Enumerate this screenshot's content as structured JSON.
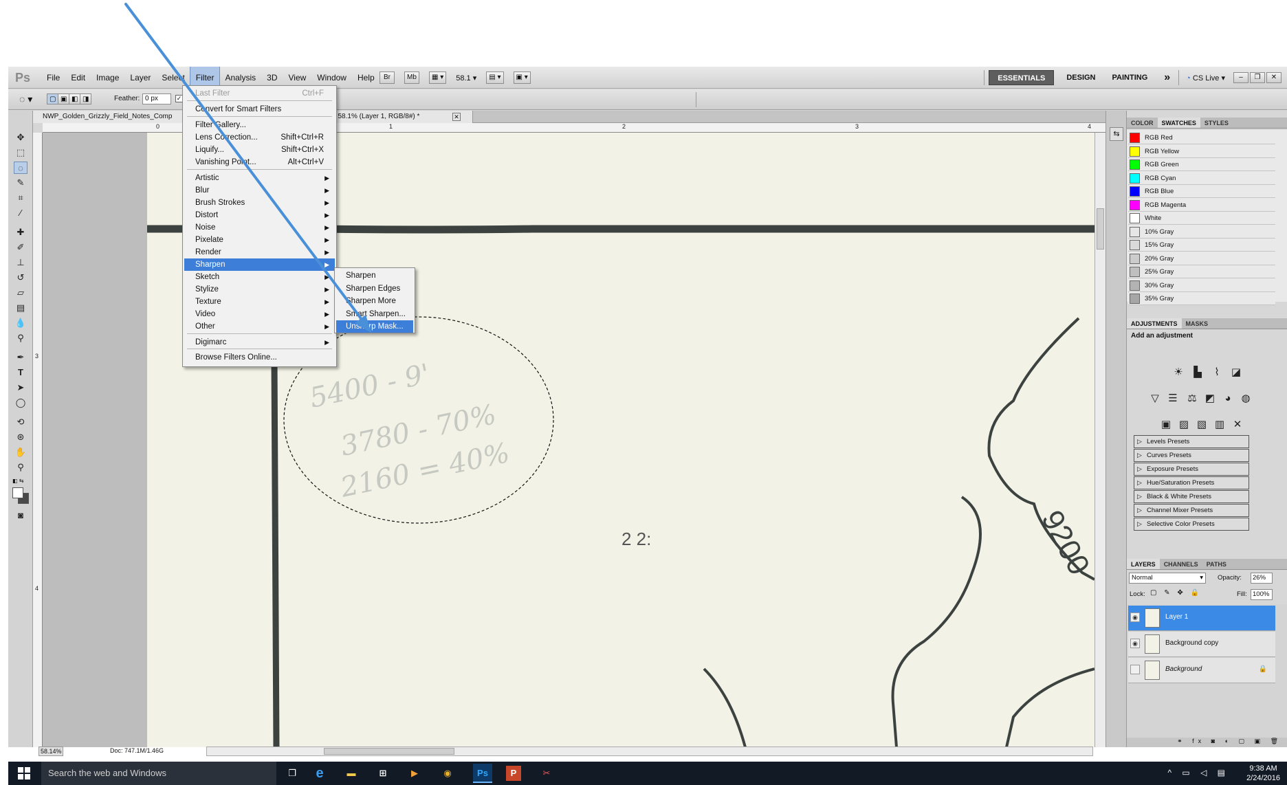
{
  "menubar": {
    "logo": "Ps",
    "menus": [
      "File",
      "Edit",
      "Image",
      "Layer",
      "Select",
      "Filter",
      "Analysis",
      "3D",
      "View",
      "Window",
      "Help"
    ],
    "active_menu": "Filter",
    "bridge_btn": "Br",
    "minibridge_btn": "Mb",
    "zoom": "58.1",
    "workspaces": [
      "ESSENTIALS",
      "DESIGN",
      "PAINTING"
    ],
    "active_workspace": "ESSENTIALS",
    "more": "»",
    "cs_live": "CS Live"
  },
  "options": {
    "feather_label": "Feather:",
    "feather_value": "0 px"
  },
  "document": {
    "tab_title_left": "NWP_Golden_Grizzly_Field_Notes_Comp",
    "tab_title_right": "tif @ 58.1% (Layer 1, RGB/8#) *",
    "close": "✕"
  },
  "rulers": {
    "top": [
      "0",
      "1",
      "2",
      "3",
      "4"
    ],
    "left": [
      "3",
      "4"
    ]
  },
  "filter_menu": {
    "items": [
      {
        "label": "Last Filter",
        "shortcut": "Ctrl+F",
        "disabled": true
      },
      {
        "label": "Convert for Smart Filters",
        "shortcut": ""
      },
      {
        "label": "Filter Gallery...",
        "shortcut": ""
      },
      {
        "label": "Lens Correction...",
        "shortcut": "Shift+Ctrl+R"
      },
      {
        "label": "Liquify...",
        "shortcut": "Shift+Ctrl+X"
      },
      {
        "label": "Vanishing Point...",
        "shortcut": "Alt+Ctrl+V"
      },
      {
        "label": "Artistic"
      },
      {
        "label": "Blur"
      },
      {
        "label": "Brush Strokes"
      },
      {
        "label": "Distort"
      },
      {
        "label": "Noise"
      },
      {
        "label": "Pixelate"
      },
      {
        "label": "Render"
      },
      {
        "label": "Sharpen"
      },
      {
        "label": "Sketch"
      },
      {
        "label": "Stylize"
      },
      {
        "label": "Texture"
      },
      {
        "label": "Video"
      },
      {
        "label": "Other"
      },
      {
        "label": "Digimarc"
      },
      {
        "label": "Browse Filters Online..."
      }
    ],
    "highlighted": "Sharpen"
  },
  "sharpen_submenu": {
    "items": [
      "Sharpen",
      "Sharpen Edges",
      "Sharpen More",
      "Smart Sharpen...",
      "Unsharp Mask..."
    ],
    "highlighted": "Unsharp Mask..."
  },
  "swatches_panel": {
    "tabs": [
      "COLOR",
      "SWATCHES",
      "STYLES"
    ],
    "active_tab": "SWATCHES",
    "swatches": [
      {
        "name": "RGB Red",
        "color": "#ff0000"
      },
      {
        "name": "RGB Yellow",
        "color": "#ffff00"
      },
      {
        "name": "RGB Green",
        "color": "#00ff00"
      },
      {
        "name": "RGB Cyan",
        "color": "#00ffff"
      },
      {
        "name": "RGB Blue",
        "color": "#0000ff"
      },
      {
        "name": "RGB Magenta",
        "color": "#ff00ff"
      },
      {
        "name": "White",
        "color": "#ffffff"
      },
      {
        "name": "10% Gray",
        "color": "#e6e6e6"
      },
      {
        "name": "15% Gray",
        "color": "#d9d9d9"
      },
      {
        "name": "20% Gray",
        "color": "#cccccc"
      },
      {
        "name": "25% Gray",
        "color": "#bfbfbf"
      },
      {
        "name": "30% Gray",
        "color": "#b3b3b3"
      },
      {
        "name": "35% Gray",
        "color": "#a6a6a6"
      }
    ]
  },
  "adjustments_panel": {
    "tabs": [
      "ADJUSTMENTS",
      "MASKS"
    ],
    "active_tab": "ADJUSTMENTS",
    "heading": "Add an adjustment",
    "presets": [
      "Levels Presets",
      "Curves Presets",
      "Exposure Presets",
      "Hue/Saturation Presets",
      "Black & White Presets",
      "Channel Mixer Presets",
      "Selective Color Presets"
    ]
  },
  "layers_panel": {
    "tabs": [
      "LAYERS",
      "CHANNELS",
      "PATHS"
    ],
    "active_tab": "LAYERS",
    "blend_mode": "Normal",
    "opacity_label": "Opacity:",
    "opacity": "26%",
    "lock_label": "Lock:",
    "fill_label": "Fill:",
    "fill": "100%",
    "layers": [
      {
        "name": "Layer 1",
        "selected": true
      },
      {
        "name": "Background copy",
        "selected": false
      },
      {
        "name": "Background",
        "selected": false,
        "locked": true
      }
    ],
    "lock_icon": "🔒"
  },
  "status": {
    "zoom": "58.14%",
    "doc": "Doc: 747.1M/1.46G"
  },
  "taskbar": {
    "search_placeholder": "Search the web and Windows",
    "ps_label": "Ps",
    "time": "9:38 AM",
    "date": "2/24/2016"
  },
  "annotation": {
    "arrow_color": "#4a90d9"
  }
}
